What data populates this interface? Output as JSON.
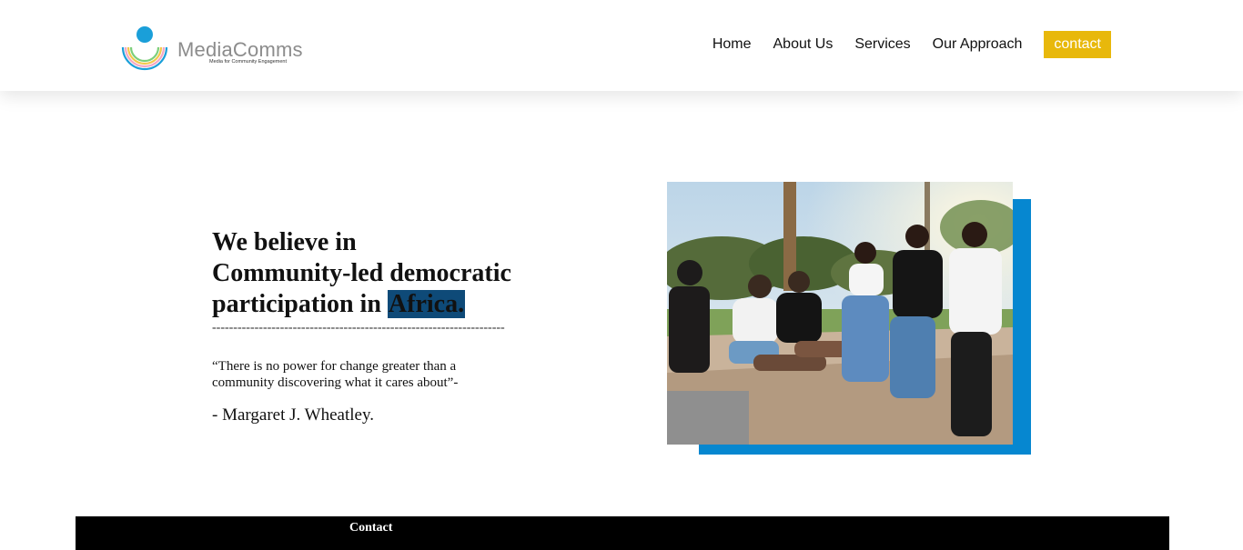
{
  "brand": {
    "name": "MediaComms",
    "tagline": "Media for Community Engagement"
  },
  "nav": {
    "items": [
      "Home",
      "About Us",
      "Services",
      "Our Approach"
    ],
    "cta": "contact",
    "cta_color": "#e8b80b"
  },
  "hero": {
    "headline_line1": "We believe in",
    "headline_line2": "Community-led democratic",
    "headline_line3_prefix": "participation in ",
    "headline_highlight": "Africa.",
    "divider": "---------------------------------------------------------------------",
    "quote": "“There is no power for change greater than a community discovering what it cares about”-",
    "author": "- Margaret J. Wheatley.",
    "highlight_color": "#0e4a78",
    "accent_color": "#0687d0"
  },
  "footer": {
    "label": "Contact"
  }
}
